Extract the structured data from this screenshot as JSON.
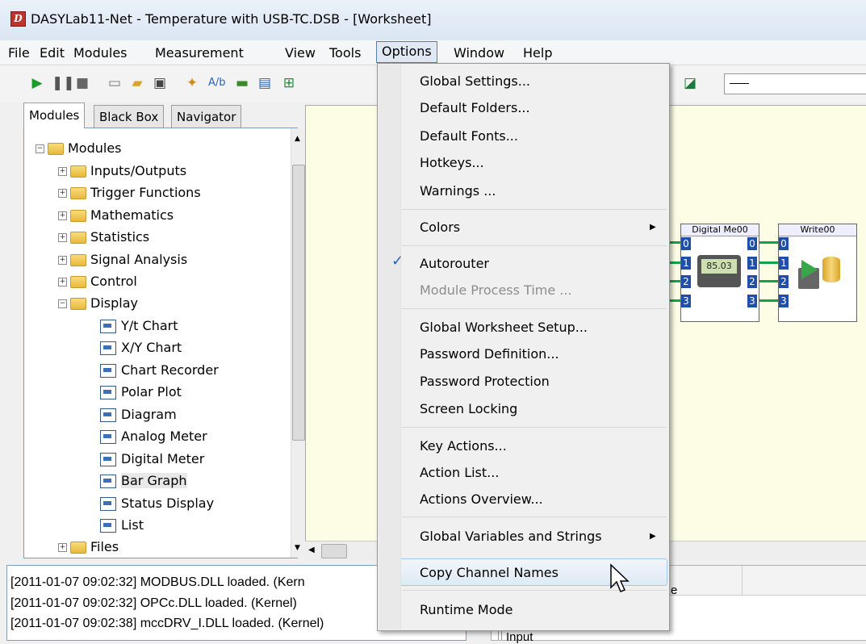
{
  "window": {
    "title": "DASYLab11-Net - Temperature with USB-TC.DSB - [Worksheet]",
    "app_icon_letter": "D"
  },
  "menubar": [
    "File",
    "Edit",
    "Modules",
    "Measurement",
    "View",
    "Tools",
    "Options",
    "Window",
    "Help"
  ],
  "tabs": [
    "Modules",
    "Black Box",
    "Navigator"
  ],
  "tree": {
    "root": "Modules",
    "groups": [
      "Inputs/Outputs",
      "Trigger Functions",
      "Mathematics",
      "Statistics",
      "Signal Analysis",
      "Control",
      "Display"
    ],
    "display_items": [
      "Y/t Chart",
      "X/Y Chart",
      "Chart Recorder",
      "Polar Plot",
      "Diagram",
      "Analog Meter",
      "Digital Meter",
      "Bar Graph",
      "Status Display",
      "List"
    ],
    "last_group": "Files"
  },
  "worksheet": {
    "blocks": [
      {
        "title": "Digital Me00",
        "channels": [
          "0",
          "1",
          "2",
          "3"
        ],
        "display": "85.03"
      },
      {
        "title": "Write00",
        "channels": [
          "0",
          "1",
          "2",
          "3"
        ]
      }
    ]
  },
  "log": [
    "[2011-01-07 09:02:32] MODBUS.DLL loaded. (Kern",
    "[2011-01-07 09:02:32] OPCc.DLL loaded. (Kernel)",
    "[2011-01-07 09:02:38] mccDRV_I.DLL loaded. (Kernel)"
  ],
  "grid": {
    "header_fragment": "e",
    "row_fragment": "Input"
  },
  "options_menu": {
    "items": [
      "Global Settings...",
      "Default Folders...",
      "Default Fonts...",
      "Hotkeys...",
      "Warnings ...",
      "Colors",
      "Autorouter",
      "Module Process Time ...",
      "Global Worksheet Setup...",
      "Password Definition...",
      "Password Protection",
      "Screen Locking",
      "Key Actions...",
      "Action List...",
      "Actions Overview...",
      "Global Variables and Strings",
      "Copy Channel Names",
      "Runtime Mode"
    ],
    "checked": "Autorouter",
    "disabled": "Module Process Time ...",
    "highlighted": "Copy Channel Names",
    "submenus": [
      "Colors",
      "Global Variables and Strings"
    ]
  },
  "colors": {
    "accent": "#2a62b8",
    "wire": "#12a34a",
    "channel": "#1f4fa8",
    "canvas": "#fdfde6"
  }
}
